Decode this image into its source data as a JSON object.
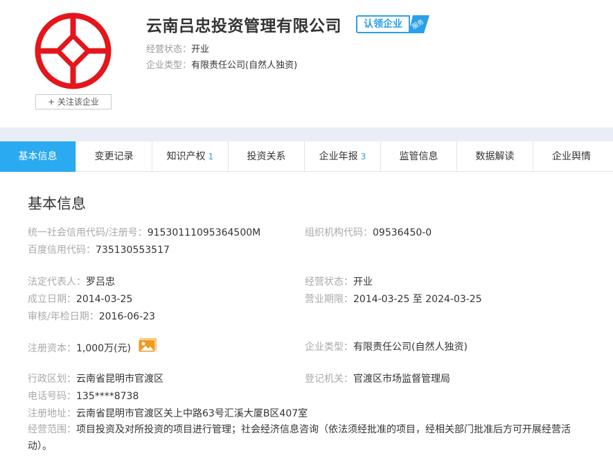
{
  "header": {
    "company_name": "云南吕忠投资管理有限公司",
    "claim_label": "认领企业",
    "claim_tag": "服务",
    "follow_button": "+ 关注该企业",
    "status_label": "经营状态：",
    "status_value": "开业",
    "type_label": "企业类型：",
    "type_value": "有限责任公司(自然人独资)",
    "logo_icon": "company-seal-icon",
    "brand_red": "#e4161b",
    "accent_blue": "#2aa0e8"
  },
  "tabs": [
    {
      "label": "基本信息",
      "count": "",
      "active": true
    },
    {
      "label": "变更记录",
      "count": ""
    },
    {
      "label": "知识产权",
      "count": "1"
    },
    {
      "label": "投资关系",
      "count": ""
    },
    {
      "label": "企业年报",
      "count": "3"
    },
    {
      "label": "监管信息",
      "count": ""
    },
    {
      "label": "数据解读",
      "count": ""
    },
    {
      "label": "企业舆情",
      "count": ""
    }
  ],
  "basic_info": {
    "title": "基本信息",
    "credit_code_label": "统一社会信用代码/注册号：",
    "credit_code_value": "91530111095364500M",
    "org_code_label": "组织机构代码：",
    "org_code_value": "09536450-0",
    "baidu_code_label": "百度信用代码：",
    "baidu_code_value": "735130553517",
    "legal_rep_label": "法定代表人：",
    "legal_rep_value": "罗吕忠",
    "status_label": "经营状态：",
    "status_value": "开业",
    "found_date_label": "成立日期：",
    "found_date_value": "2014-03-25",
    "term_label": "营业期限：",
    "term_value": "2014-03-25 至 2024-03-25",
    "audit_date_label": "审核/年检日期：",
    "audit_date_value": "2016-06-23",
    "capital_label": "注册资本：",
    "capital_value": "1,000万(元)",
    "capital_icon": "image-icon",
    "company_type_label": "企业类型：",
    "company_type_value": "有限责任公司(自然人独资)",
    "district_label": "行政区划：",
    "district_value": "云南省昆明市官渡区",
    "registry_label": "登记机关：",
    "registry_value": "官渡区市场监督管理局",
    "phone_label": "电话号码：",
    "phone_value": "135****8738",
    "address_label": "注册地址：",
    "address_value": "云南省昆明市官渡区关上中路63号汇溪大厦B区407室",
    "scope_label": "经营范围：",
    "scope_value": "项目投资及对所投资的项目进行管理；社会经济信息咨询（依法须经批准的项目，经相关部门批准后方可开展经营活动）。"
  }
}
